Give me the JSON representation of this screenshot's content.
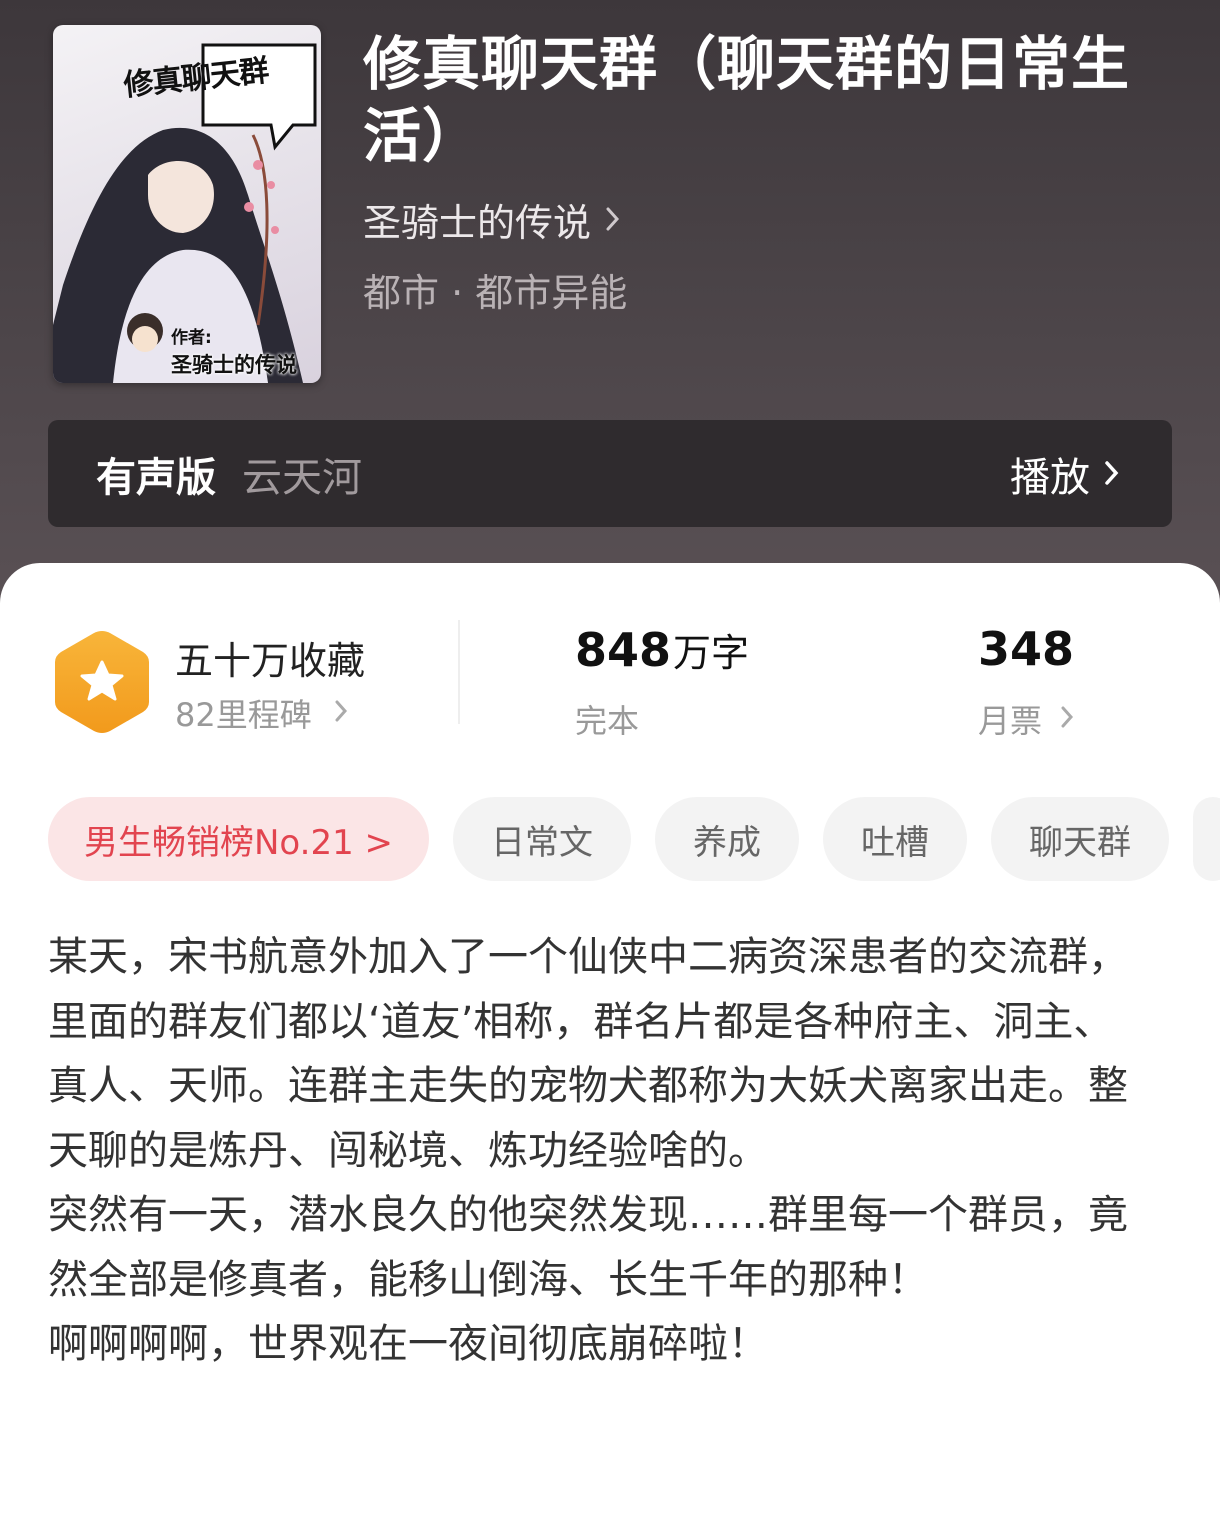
{
  "book": {
    "title": "修真聊天群（聊天群的日常生活）",
    "author": "圣骑士的传说",
    "category": "都市 · 都市异能",
    "cover": {
      "title_art": "修真聊天群",
      "author_label": "作者:",
      "author_name": "圣骑士的传说"
    }
  },
  "audio": {
    "label": "有声版",
    "narrator": "云天河",
    "play_label": "播放"
  },
  "stats": {
    "collection": {
      "title": "五十万收藏",
      "subtitle": "82里程碑"
    },
    "words": {
      "value": "848",
      "unit": "万字",
      "status": "完本"
    },
    "votes": {
      "value": "348",
      "label": "月票"
    }
  },
  "tags": {
    "rank": "男生畅销榜No.21 >",
    "items": [
      "日常文",
      "养成",
      "吐槽",
      "聊天群"
    ]
  },
  "intro": {
    "paragraphs": [
      "某天，宋书航意外加入了一个仙侠中二病资深患者的交流群，里面的群友们都以‘道友’相称，群名片都是各种府主、洞主、真人、天师。连群主走失的宠物犬都称为大妖犬离家出走。整天聊的是炼丹、闯秘境、炼功经验啥的。",
      "突然有一天，潜水良久的他突然发现……群里每一个群员，竟然全部是修真者，能移山倒海、长生千年的那种！",
      "啊啊啊啊，世界观在一夜间彻底崩碎啦！"
    ]
  },
  "colors": {
    "hero_bg": "#453f43",
    "rank_tag_bg": "#fbe5e6",
    "rank_tag_text": "#e2444f",
    "badge_orange": "#f5a623"
  },
  "icons": {
    "author_chevron": "chevron-right-icon",
    "play_chevron": "chevron-right-icon",
    "badge": "star-hexagon-icon"
  }
}
